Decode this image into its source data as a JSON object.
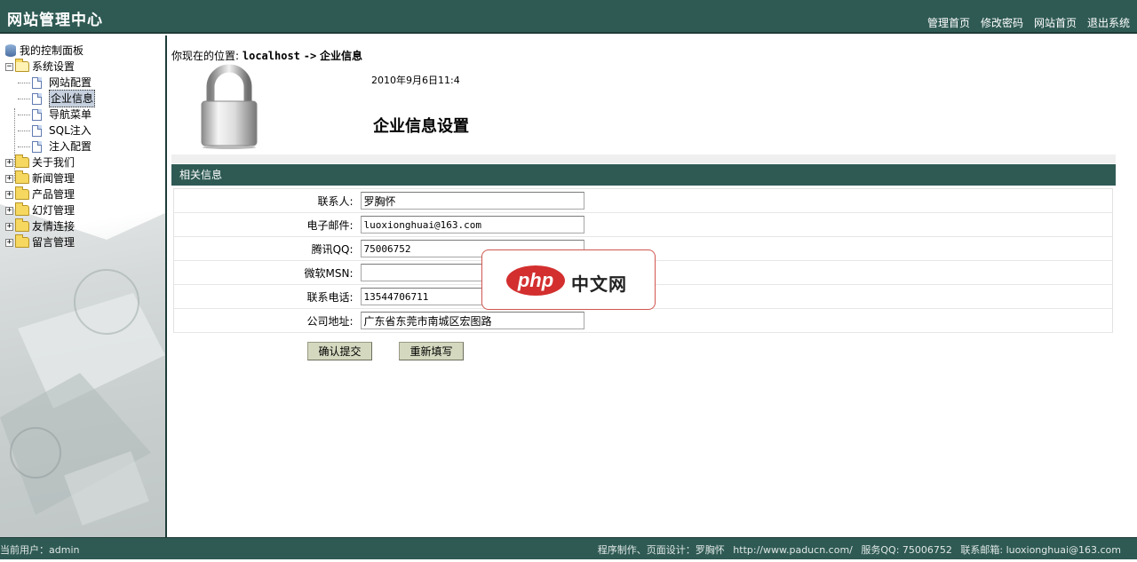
{
  "header": {
    "title": "网站管理中心",
    "nav": [
      "管理首页",
      "修改密码",
      "网站首页",
      "退出系统"
    ]
  },
  "sidebar": {
    "root": "我的控制面板",
    "group_open": "系统设置",
    "children": [
      "网站配置",
      "企业信息",
      "导航菜单",
      "SQL注入",
      "注入配置"
    ],
    "groups": [
      "关于我们",
      "新闻管理",
      "产品管理",
      "幻灯管理",
      "友情连接",
      "留言管理"
    ],
    "expand_symbol": "+",
    "collapse_symbol": "−"
  },
  "main": {
    "crumb_prefix": "你现在的位置:",
    "crumb_host": "localhost",
    "crumb_arrow": "->",
    "crumb_page": "企业信息",
    "date": "2010年9月6日11:4",
    "heading": "企业信息设置",
    "section_title": "相关信息",
    "fields": [
      {
        "label": "联系人:",
        "value": "罗胸怀"
      },
      {
        "label": "电子邮件:",
        "value": "luoxionghuai@163.com"
      },
      {
        "label": "腾讯QQ:",
        "value": "75006752"
      },
      {
        "label": "微软MSN:",
        "value": ""
      },
      {
        "label": "联系电话:",
        "value": "13544706711"
      },
      {
        "label": "公司地址:",
        "value": "广东省东莞市南城区宏图路"
      }
    ],
    "submit_label": "确认提交",
    "reset_label": "重新填写"
  },
  "watermark": {
    "logo": "php",
    "text": "中文网"
  },
  "footer": {
    "user": "当前用户：admin",
    "credits": "程序制作、页面设计：罗胸怀",
    "url": "http://www.paducn.com/",
    "qq": "服务QQ:  75006752",
    "email": "联系邮箱:   luoxionghuai@163.com"
  },
  "colors": {
    "accent": "#2f5a54",
    "button": "#d4d8bf"
  }
}
